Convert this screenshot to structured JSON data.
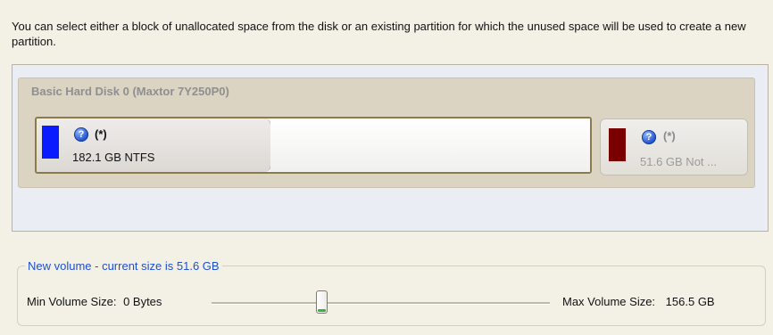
{
  "instructions": "You can select either a block of unallocated space from the disk or an existing partition for which the unused space will be used to create a new partition.",
  "disk": {
    "header": "Basic Hard Disk 0 (Maxtor 7Y250P0)",
    "partitions": [
      {
        "mark": "(*)",
        "size_label": "182.1 GB NTFS",
        "color": "#0b1bff",
        "selected": true
      },
      {
        "mark": "(*)",
        "size_label": "51.6 GB Not ...",
        "color": "#7a0000",
        "selected": false
      }
    ]
  },
  "new_volume": {
    "legend": "New volume - current size is 51.6 GB",
    "min_label": "Min Volume Size:",
    "min_value": "0 Bytes",
    "max_label": "Max Volume Size:",
    "max_value": "156.5 GB",
    "slider_fraction": 0.33
  },
  "icons": {
    "help": "help-question-icon"
  }
}
